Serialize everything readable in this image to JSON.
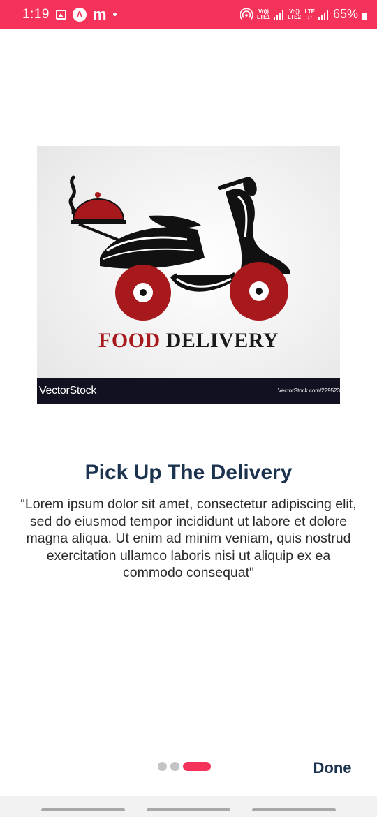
{
  "status_bar": {
    "time": "1:19",
    "network_1": "Vo)) LTE1",
    "network_2": "Vo)) LTE2",
    "battery": "65%",
    "background_color": "#f5335a",
    "icons": [
      "gallery-icon",
      "a-app-icon",
      "m-app-icon",
      "notification-dot-icon",
      "hotspot-icon",
      "signal-icon",
      "battery-icon"
    ]
  },
  "illustration": {
    "logo_word_1": "FOOD",
    "logo_word_2": "DELIVERY",
    "watermark_brand": "VectorStock",
    "watermark_url": "VectorStock.com/229523"
  },
  "onboarding": {
    "title": "Pick Up The Delivery",
    "body": "“Lorem ipsum dolor sit amet, consectetur adipiscing elit, sed do eiusmod tempor incididunt ut labore et dolore magna aliqua. Ut enim ad minim veniam, quis nostrud exercitation ullamco laboris nisi ut aliquip ex ea commodo consequat\""
  },
  "pager": {
    "page_count": 3,
    "current_page": 3,
    "accent_color": "#f5335a"
  },
  "actions": {
    "done_label": "Done"
  },
  "colors": {
    "title": "#1c3350",
    "accent": "#f5335a"
  }
}
